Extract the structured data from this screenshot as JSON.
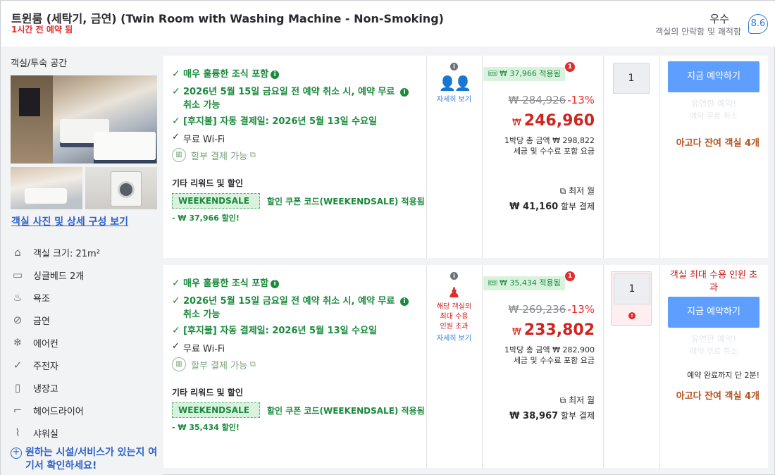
{
  "header": {
    "title": "트윈룸 (세탁기, 금연) (Twin Room with Washing Machine - Non-Smoking)",
    "booked": "1시간 전 예약 됨",
    "score_word": "우수",
    "score_sub": "객실의 안락함 및 쾌적함",
    "score": "8.6"
  },
  "sidebar": {
    "room_space": "객실/투숙 공간",
    "photo_link": "객실 사진 및 상세 구성 보기",
    "amenities": [
      {
        "icon": "room-size-icon",
        "glyph": "⌂",
        "label": "객실 크기: 21m²"
      },
      {
        "icon": "bed-icon",
        "glyph": "▭",
        "label": "싱글베드 2개"
      },
      {
        "icon": "bathtub-icon",
        "glyph": "♨",
        "label": "욕조"
      },
      {
        "icon": "no-smoking-icon",
        "glyph": "⊘",
        "label": "금연"
      },
      {
        "icon": "air-conditioner-icon",
        "glyph": "❄",
        "label": "에어컨"
      },
      {
        "icon": "check-circle-icon",
        "glyph": "✓",
        "label": "주전자"
      },
      {
        "icon": "refrigerator-icon",
        "glyph": "▯",
        "label": "냉장고"
      },
      {
        "icon": "hair-dryer-icon",
        "glyph": "⌐",
        "label": "헤어드라이어"
      },
      {
        "icon": "shower-icon",
        "glyph": "⌇",
        "label": "샤워실"
      }
    ],
    "find_link": "원하는 시설/서비스가 있는지 여기서 확인하세요!"
  },
  "offers": [
    {
      "features": [
        "매우 훌륭한 조식 포함",
        "2026년 5월 15일 금요일 전 예약 취소 시, 예약 무료 취소 가능",
        "[후지불] 자동 결제일: 2026년 5월 13일 수요일"
      ],
      "wifi": "무료 Wi-Fi",
      "installment": "할부 결제 가능",
      "other_title": "기타 리워드 및 할인",
      "coupon": "WEEKENDSALE",
      "coupon_text": "할인 쿠폰 코드(WEEKENDSALE) 적용됨",
      "discount": "- ₩ 37,966 할인!",
      "occupancy_more": "자세히 보기",
      "occupancy_warning": "",
      "applied": "₩ 37,966 적용됨",
      "notif": "1",
      "original_price": "₩ 284,926",
      "percent": "-13%",
      "currency": "₩",
      "price": "246,960",
      "total_line1": "1박당 총 금액 ₩ 298,822",
      "total_line2": "세금 및 수수료 포함 요금",
      "cheapest_label": "최저 월",
      "monthly_amount": "₩ 41,160",
      "monthly_suffix": "할부 결제",
      "qty": "1",
      "book": "지금 예약하기",
      "flex_title": "유연한 예약!",
      "flex_sub": "예약 무료 취소",
      "rooms_left": "아고다 잔여 객실 4개",
      "cap_warn": "",
      "only_left": ""
    },
    {
      "features": [
        "매우 훌륭한 조식 포함",
        "2026년 5월 15일 금요일 전 예약 취소 시, 예약 무료 취소 가능",
        "[후지불] 자동 결제일: 2026년 5월 13일 수요일"
      ],
      "wifi": "무료 Wi-Fi",
      "installment": "할부 결제 가능",
      "other_title": "기타 리워드 및 할인",
      "coupon": "WEEKENDSALE",
      "coupon_text": "할인 쿠폰 코드(WEEKENDSALE) 적용됨",
      "discount": "- ₩ 35,434 할인!",
      "occupancy_more": "자세히 보기",
      "occupancy_warning": "해당 객실의 최대 수용 인원 초과",
      "applied": "₩ 35,434 적용됨",
      "notif": "1",
      "original_price": "₩ 269,236",
      "percent": "-13%",
      "currency": "₩",
      "price": "233,802",
      "total_line1": "1박당 총 금액 ₩ 282,900",
      "total_line2": "세금 및 수수료 포함 요금",
      "cheapest_label": "최저 월",
      "monthly_amount": "₩ 38,967",
      "monthly_suffix": "할부 결제",
      "qty": "1",
      "book": "지금 예약하기",
      "flex_title": "유연한 예약!",
      "flex_sub": "예약 무료 취소",
      "rooms_left": "아고다 잔여 객실 4개",
      "cap_warn": "객실 최대 수용 인원 초과",
      "only_left": "예약 완료까지 단 2분!"
    }
  ]
}
